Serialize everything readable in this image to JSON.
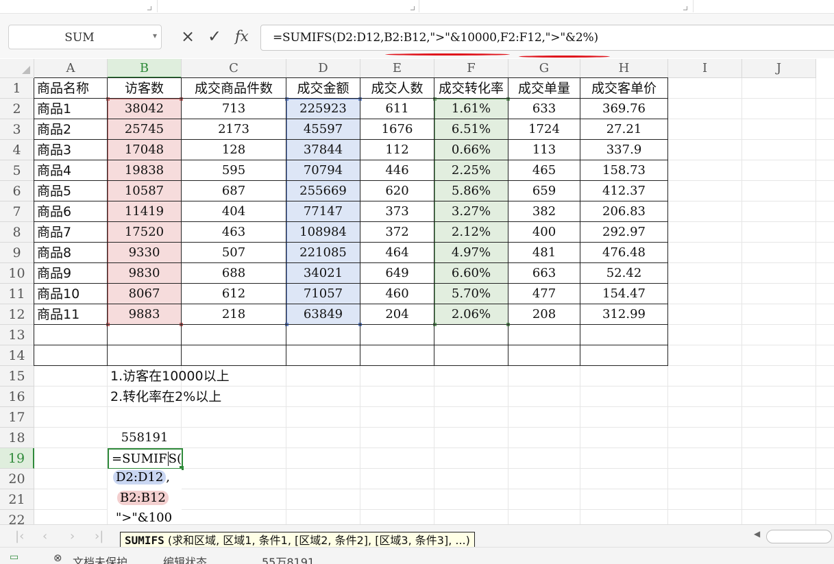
{
  "name_box": {
    "value": "SUM"
  },
  "formula_bar": {
    "cancel_symbol": "×",
    "enter_symbol": "✓",
    "fx_label": "fx",
    "formula": "=SUMIFS(D2:D12,B2:B12,\">\"&10000,F2:F12,\">\"&2%)"
  },
  "columns": [
    "A",
    "B",
    "C",
    "D",
    "E",
    "F",
    "G",
    "H",
    "I",
    "J"
  ],
  "rows": [
    "1",
    "2",
    "3",
    "4",
    "5",
    "6",
    "7",
    "8",
    "9",
    "10",
    "11",
    "12",
    "13",
    "14",
    "15",
    "16",
    "17",
    "18",
    "19",
    "20",
    "21",
    "22"
  ],
  "table": {
    "headers": [
      "商品名称",
      "访客数",
      "成交商品件数",
      "成交金额",
      "成交人数",
      "成交转化率",
      "成交单量",
      "成交客单价"
    ],
    "rows": [
      [
        "商品1",
        "38042",
        "713",
        "225923",
        "611",
        "1.61%",
        "633",
        "369.76"
      ],
      [
        "商品2",
        "25745",
        "2173",
        "45597",
        "1676",
        "6.51%",
        "1724",
        "27.21"
      ],
      [
        "商品3",
        "17048",
        "128",
        "37844",
        "112",
        "0.66%",
        "113",
        "337.9"
      ],
      [
        "商品4",
        "19838",
        "595",
        "70794",
        "446",
        "2.25%",
        "465",
        "158.73"
      ],
      [
        "商品5",
        "10587",
        "687",
        "255669",
        "620",
        "5.86%",
        "659",
        "412.37"
      ],
      [
        "商品6",
        "11419",
        "404",
        "77147",
        "373",
        "3.27%",
        "382",
        "206.83"
      ],
      [
        "商品7",
        "17520",
        "463",
        "108984",
        "372",
        "2.12%",
        "400",
        "292.97"
      ],
      [
        "商品8",
        "9330",
        "507",
        "221085",
        "464",
        "4.97%",
        "481",
        "476.48"
      ],
      [
        "商品9",
        "9830",
        "688",
        "34021",
        "649",
        "6.60%",
        "663",
        "52.42"
      ],
      [
        "商品10",
        "8067",
        "612",
        "71057",
        "460",
        "5.70%",
        "477",
        "154.47"
      ],
      [
        "商品11",
        "9883",
        "218",
        "63849",
        "204",
        "2.06%",
        "208",
        "312.99"
      ]
    ]
  },
  "notes": [
    "1.访客在10000以上",
    "2.转化率在2%以上"
  ],
  "result_value": "558191",
  "editing": {
    "line1_a": "=SUMIF",
    "line1_b": "S(",
    "line2_ref": "D2:D12",
    "line2_rest": ",",
    "line3_ref": "B2:B12",
    "line4": "\">\"&100"
  },
  "tooltip": {
    "func": "SUMIFS",
    "args": " (求和区域, 区域1, 条件1, [区域2, 条件2], [区域3, 条件3], ...)"
  },
  "status_bar": {
    "protect": "文档未保护",
    "mode": "编辑状态",
    "sum": "55万8191"
  },
  "colors": {
    "selection_green": "#2f8a3a",
    "ref_red": "#f6dcdc",
    "ref_blue": "#dde6f6",
    "ref_green": "#e2eedf",
    "annotation_red": "#e0141c"
  }
}
